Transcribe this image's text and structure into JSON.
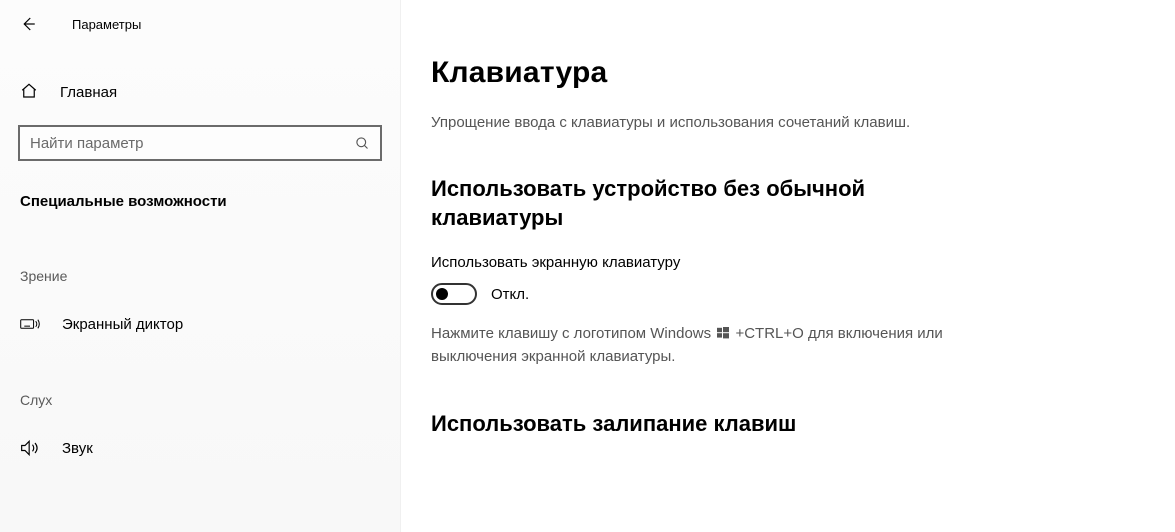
{
  "window": {
    "title": "Параметры"
  },
  "sidebar": {
    "home": "Главная",
    "search_placeholder": "Найти параметр",
    "category": "Специальные возможности",
    "groups": [
      {
        "label": "Зрение",
        "items": [
          {
            "icon": "narrator",
            "label": "Экранный диктор"
          }
        ]
      },
      {
        "label": "Слух",
        "items": [
          {
            "icon": "sound",
            "label": "Звук"
          }
        ]
      }
    ]
  },
  "main": {
    "title": "Клавиатура",
    "subtitle": "Упрощение ввода с клавиатуры и использования сочетаний клавиш.",
    "section1": {
      "heading": "Использовать устройство без обычной клавиатуры",
      "setting_label": "Использовать экранную клавиатуру",
      "toggle_state": "Откл.",
      "hint_before": "Нажмите клавишу с логотипом Windows ",
      "hint_after": " +CTRL+O для включения или выключения экранной клавиатуры."
    },
    "section2": {
      "heading": "Использовать залипание клавиш"
    }
  }
}
